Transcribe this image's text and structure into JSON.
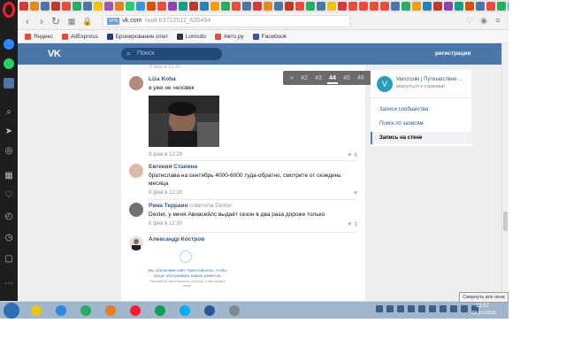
{
  "tabs": {
    "tab_colors": [
      "#d43c3c",
      "#e58a1f",
      "#4a76a8",
      "#c0392b",
      "#e74c3c",
      "#27ae60",
      "#4a76a8",
      "#f1c40f",
      "#9b59b6",
      "#e67e22",
      "#2ecc71",
      "#3498db",
      "#d35400",
      "#e74c3c",
      "#8e44ad",
      "#16a085",
      "#c0392b",
      "#2980b9",
      "#f39c12",
      "#27ae60",
      "#e74c3c",
      "#4a76a8",
      "#d43c3c",
      "#e58a1f",
      "#4a76a8",
      "#c0392b",
      "#e74c3c",
      "#27ae60",
      "#4a76a8",
      "#f1c40f",
      "#d43c3c",
      "#e74c3c",
      "#e74c3c",
      "#e74c3c",
      "#e74c3c",
      "#4a76a8",
      "#27ae60",
      "#f39c12",
      "#2980b9",
      "#c0392b",
      "#8e44ad",
      "#16a085",
      "#d35400",
      "#4a76a8",
      "#e74c3c",
      "#27ae60",
      "#3498db"
    ]
  },
  "address": {
    "vpn": "VPN",
    "host": "vk.com",
    "path": "/wall-63722512_635494"
  },
  "bookmarks": [
    {
      "label": "Яндекс",
      "color": "#e74c3c"
    },
    {
      "label": "AliExpress",
      "color": "#e74c3c"
    },
    {
      "label": "Бронирование отел",
      "color": "#1f3f7a"
    },
    {
      "label": "Lomcdo",
      "color": "#333333"
    },
    {
      "label": "Авто.ру",
      "color": "#e74c3c"
    },
    {
      "label": "Facebook",
      "color": "#3b5998"
    }
  ],
  "vk": {
    "logo": "VK",
    "search_placeholder": "Поиск",
    "register": "регистрация",
    "cut_date": "8 фев в 12:29"
  },
  "pager": {
    "prev": "«",
    "pages": [
      "42",
      "43",
      "44",
      "45",
      "46"
    ],
    "active": "44",
    "next": "»"
  },
  "comments": [
    {
      "name": "Liza Koba",
      "note": "",
      "text": "я уже не человек",
      "date": "8 фев в 12:29",
      "likes": "6"
    },
    {
      "name": "Евгения Станина",
      "note": "",
      "text": "братислава на сентябрь 4000-6000 туда-обратно, смотрите от сезединь месяца",
      "date": "8 фев в 12:29",
      "likes": ""
    },
    {
      "name": "Рина Терраин",
      "note": "ответила Dexter",
      "text": "Dexter, у меня Авиасейлс выдаёт сезон в два раза дороже только",
      "date": "8 фев в 12:30",
      "likes": "1"
    },
    {
      "name": "Александр Костров",
      "note": "",
      "text": "",
      "date": "",
      "likes": ""
    }
  ],
  "loader": {
    "text": "Мы обновляем сайт. Приготовьтесь, чтобы лучше обслуживать наших клиентов.",
    "subtext": "Пожалуйста, перезагрузите страницу, чтобы увидеть новое."
  },
  "community": {
    "avatar_letter": "V",
    "title": "Vancrouki | Путешествия ...",
    "back": "вернуться к странице",
    "menu": [
      "Записи сообщества",
      "Поиск по записям",
      "Запись на стене"
    ],
    "active_item": "Запись на стене"
  },
  "taskbar": {
    "apps": [
      "#f1c40f",
      "#2e86de",
      "#27ae60",
      "#e67e22",
      "#ff1b2d",
      "#0f9d58",
      "#00aff0",
      "#2b5797",
      "#7f8c8d"
    ],
    "time": "13:57",
    "date": "23.10.2018"
  },
  "tooltip": "Свернуть все окна"
}
